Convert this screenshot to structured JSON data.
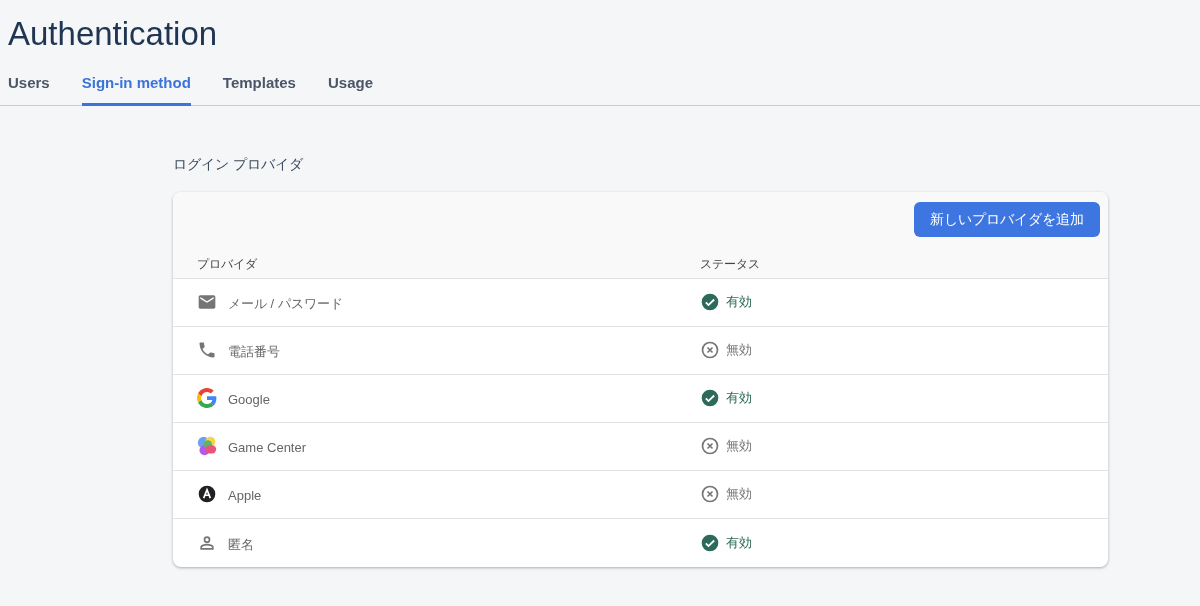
{
  "page": {
    "title": "Authentication"
  },
  "tabs": [
    {
      "label": "Users",
      "selected": false
    },
    {
      "label": "Sign-in method",
      "selected": true
    },
    {
      "label": "Templates",
      "selected": false
    },
    {
      "label": "Usage",
      "selected": false
    }
  ],
  "section": {
    "title": "ログイン プロバイダ"
  },
  "add_button": {
    "label": "新しいプロバイダを追加"
  },
  "table": {
    "columns": [
      "プロバイダ",
      "ステータス"
    ],
    "rows": [
      {
        "kind": "email",
        "name": "メール / パスワード",
        "enabled": true,
        "status": "有効"
      },
      {
        "kind": "phone",
        "name": "電話番号",
        "enabled": false,
        "status": "無効"
      },
      {
        "kind": "google",
        "name": "Google",
        "enabled": true,
        "status": "有効"
      },
      {
        "kind": "gamecenter",
        "name": "Game Center",
        "enabled": false,
        "status": "無効"
      },
      {
        "kind": "apple",
        "name": "Apple",
        "enabled": false,
        "status": "無効"
      },
      {
        "kind": "anonymous",
        "name": "匿名",
        "enabled": true,
        "status": "有効"
      }
    ]
  }
}
